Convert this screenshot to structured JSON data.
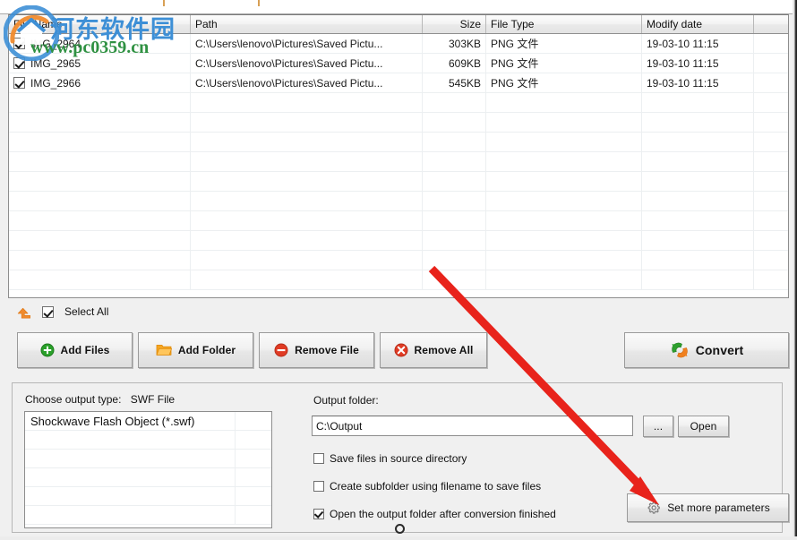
{
  "window": {
    "accent_blue": "#3d8fd6",
    "accent_green": "#2f9142",
    "annotation_color": "#e8231b",
    "panel_bg": "#f0f0f0"
  },
  "file_list": {
    "columns": [
      {
        "key": "name",
        "label": "File Name"
      },
      {
        "key": "path",
        "label": "Path"
      },
      {
        "key": "size",
        "label": "Size"
      },
      {
        "key": "type",
        "label": "File Type"
      },
      {
        "key": "date",
        "label": "Modify date"
      },
      {
        "key": "extra",
        "label": ""
      }
    ],
    "rows": [
      {
        "checked": true,
        "name": "IMG_2964",
        "path": "C:\\Users\\lenovo\\Pictures\\Saved Pictu...",
        "size": "303KB",
        "type": "PNG 文件",
        "date": "19-03-10 11:15"
      },
      {
        "checked": true,
        "name": "IMG_2965",
        "path": "C:\\Users\\lenovo\\Pictures\\Saved Pictu...",
        "size": "609KB",
        "type": "PNG 文件",
        "date": "19-03-10 11:15"
      },
      {
        "checked": true,
        "name": "IMG_2966",
        "path": "C:\\Users\\lenovo\\Pictures\\Saved Pictu...",
        "size": "545KB",
        "type": "PNG 文件",
        "date": "19-03-10 11:15"
      }
    ],
    "empty_row_count": 10
  },
  "select_all": {
    "label": "Select All",
    "checked": true,
    "move_up_icon": "up-arrow-icon"
  },
  "toolbar": {
    "add_files": {
      "label": "Add Files",
      "icon": "plus-circle-icon"
    },
    "add_folder": {
      "label": "Add Folder",
      "icon": "folder-icon"
    },
    "remove_file": {
      "label": "Remove File",
      "icon": "minus-circle-icon"
    },
    "remove_all": {
      "label": "Remove All",
      "icon": "close-circle-icon"
    },
    "convert": {
      "label": "Convert",
      "icon": "convert-arrows-icon"
    }
  },
  "output": {
    "type_label": "Choose output type:",
    "type_value": "SWF File",
    "type_options": [
      "Shockwave Flash Object (*.swf)"
    ],
    "type_empty_rows": 5,
    "folder_label": "Output folder:",
    "folder_value": "C:\\Output",
    "folder_placeholder": "Output folder",
    "browse_label": "...",
    "open_label": "Open",
    "options": [
      {
        "label": "Save files in source directory",
        "checked": false
      },
      {
        "label": "Create subfolder using filename to save files",
        "checked": false
      },
      {
        "label": "Open the output folder after conversion finished",
        "checked": true
      }
    ],
    "params_button": {
      "label": "Set more parameters",
      "icon": "gear-icon"
    }
  },
  "watermark": {
    "logo_icon": "site-logo-icon",
    "site_name": "河东软件园",
    "site_url": "www.pc0359.cn"
  }
}
